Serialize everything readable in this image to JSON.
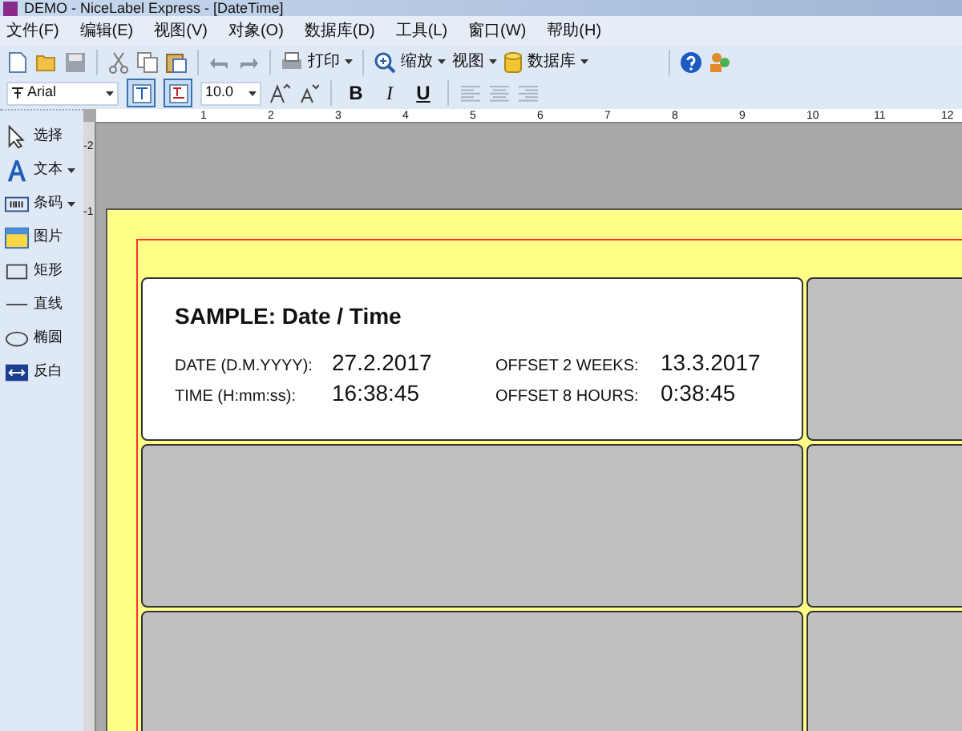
{
  "window": {
    "title": "DEMO - NiceLabel Express - [DateTime]"
  },
  "menu": [
    "文件(F)",
    "编辑(E)",
    "视图(V)",
    "对象(O)",
    "数据库(D)",
    "工具(L)",
    "窗口(W)",
    "帮助(H)"
  ],
  "toolbar": {
    "print": "打印",
    "zoom": "缩放",
    "view": "视图",
    "database": "数据库"
  },
  "format_bar": {
    "font": "Arial",
    "size": "10.0",
    "toggles": [
      {
        "kind": "text",
        "on": true
      },
      {
        "kind": "print",
        "on": true
      }
    ],
    "styles": [
      "B",
      "I",
      "U"
    ]
  },
  "tools": [
    {
      "kind": "select",
      "label": "选择",
      "menu": false
    },
    {
      "kind": "text",
      "label": "文本",
      "menu": true
    },
    {
      "kind": "barcode",
      "label": "条码",
      "menu": true
    },
    {
      "kind": "picture",
      "label": "图片",
      "menu": false
    },
    {
      "kind": "rect",
      "label": "矩形",
      "menu": false
    },
    {
      "kind": "line",
      "label": "直线",
      "menu": false
    },
    {
      "kind": "ellipse",
      "label": "椭圆",
      "menu": false
    },
    {
      "kind": "inverse",
      "label": "反白",
      "menu": false
    }
  ],
  "ruler": {
    "horizontal": [
      "1",
      "2",
      "3",
      "4",
      "5",
      "6",
      "7",
      "8",
      "9",
      "10",
      "11",
      "12"
    ],
    "vertical": [
      "-2",
      "-1"
    ]
  },
  "label": {
    "title": "SAMPLE: Date / Time",
    "fields": [
      {
        "name": "DATE (D.M.YYYY):",
        "value": "27.2.2017"
      },
      {
        "name": "OFFSET 2 WEEKS:",
        "value": "13.3.2017"
      },
      {
        "name": "TIME (H:mm:ss):",
        "value": "16:38:45"
      },
      {
        "name": "OFFSET 8 HOURS:",
        "value": "0:38:45"
      }
    ]
  }
}
